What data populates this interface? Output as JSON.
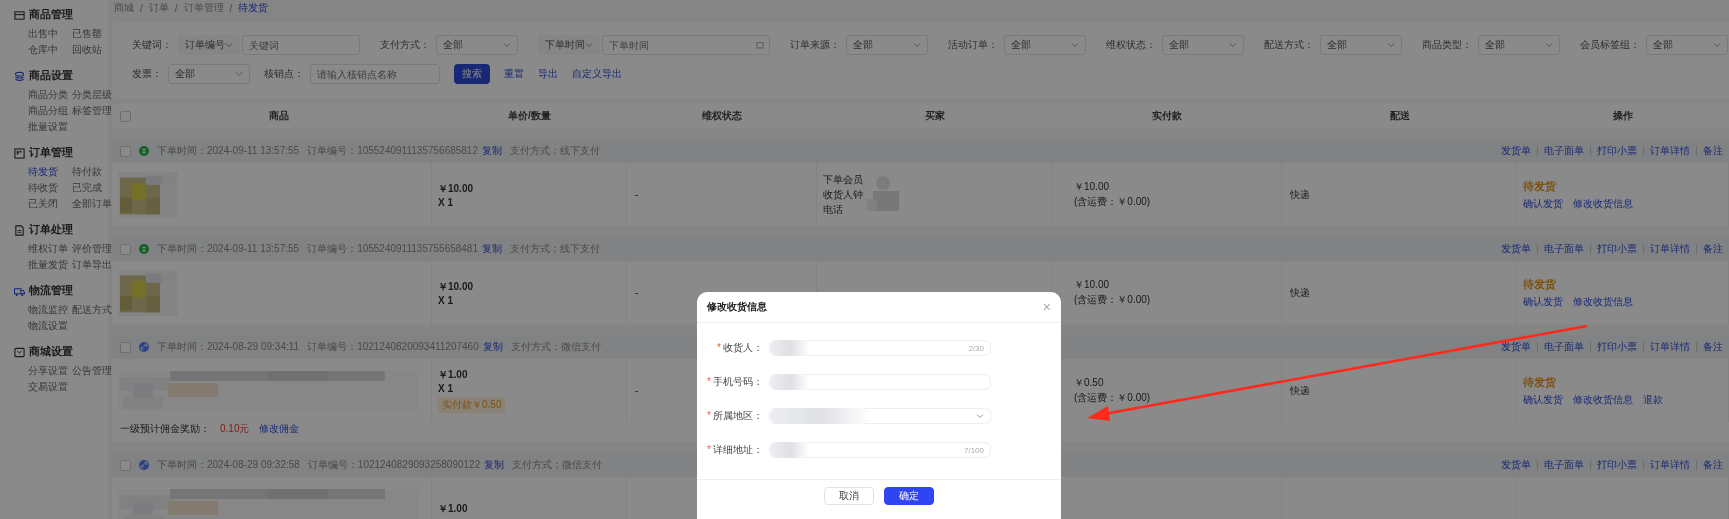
{
  "sidebar": {
    "groups": [
      {
        "title": "商品管理",
        "items": [
          {
            "label": "出售中",
            "selected": false
          },
          {
            "label": "已售罄",
            "selected": false
          },
          {
            "label": "仓库中",
            "selected": false
          },
          {
            "label": "回收站",
            "selected": false
          }
        ]
      },
      {
        "title": "商品设置",
        "items": [
          {
            "label": "商品分类",
            "selected": false
          },
          {
            "label": "分类层级",
            "selected": false
          },
          {
            "label": "商品分组",
            "selected": false
          },
          {
            "label": "标签管理",
            "selected": false
          },
          {
            "label": "批量设置",
            "selected": false
          }
        ]
      },
      {
        "title": "订单管理",
        "items": [
          {
            "label": "待发货",
            "selected": true
          },
          {
            "label": "待付款",
            "selected": false
          },
          {
            "label": "待收货",
            "selected": false
          },
          {
            "label": "已完成",
            "selected": false
          },
          {
            "label": "已关闭",
            "selected": false
          },
          {
            "label": "全部订单",
            "selected": false
          }
        ]
      },
      {
        "title": "订单处理",
        "items": [
          {
            "label": "维权订单",
            "selected": false
          },
          {
            "label": "评价管理",
            "selected": false
          },
          {
            "label": "批量发货",
            "selected": false
          },
          {
            "label": "订单导出",
            "selected": false
          }
        ]
      },
      {
        "title": "物流管理",
        "items": [
          {
            "label": "物流监控",
            "selected": false
          },
          {
            "label": "配送方式",
            "selected": false
          },
          {
            "label": "物流设置",
            "selected": false
          }
        ]
      },
      {
        "title": "商城设置",
        "items": [
          {
            "label": "分享设置",
            "selected": false
          },
          {
            "label": "公告管理",
            "selected": false
          },
          {
            "label": "交易设置",
            "selected": false
          }
        ]
      }
    ]
  },
  "breadcrumb": {
    "separator": "/",
    "items": [
      {
        "label": "商城",
        "selected": false
      },
      {
        "label": "订单",
        "selected": false
      },
      {
        "label": "订单管理",
        "selected": false
      },
      {
        "label": "待发货",
        "selected": true
      }
    ]
  },
  "filters": {
    "first_line": [
      {
        "kind": "select-input",
        "label": "关键词：",
        "select": "订单编号",
        "placeholder": "关键词"
      },
      {
        "kind": "select",
        "label": "支付方式：",
        "value": "全部"
      },
      {
        "kind": "date",
        "select": "下单时间",
        "placeholder": "下单时间"
      },
      {
        "kind": "select",
        "label": "订单来源：",
        "value": "全部"
      },
      {
        "kind": "select",
        "label": "活动订单：",
        "value": "全部"
      },
      {
        "kind": "select",
        "label": "维权状态：",
        "value": "全部"
      },
      {
        "kind": "select",
        "label": "配送方式：",
        "value": "全部"
      },
      {
        "kind": "select",
        "label": "商品类型：",
        "value": "全部"
      },
      {
        "kind": "select",
        "label": "会员标签组：",
        "value": "全部"
      }
    ],
    "second_line": [
      {
        "kind": "select",
        "label": "发票：",
        "value": "全部"
      },
      {
        "kind": "input",
        "label": "核销点：",
        "placeholder": "请输入核销点名称"
      },
      {
        "kind": "button",
        "label": "搜索"
      },
      {
        "kind": "link",
        "label": "重置"
      },
      {
        "kind": "link",
        "label": "导出"
      },
      {
        "kind": "link",
        "label": "自定义导出"
      }
    ]
  },
  "table": {
    "checked": false,
    "columns": [
      "商品",
      "单价/数量",
      "维权状态",
      "买家",
      "实付款",
      "配送",
      "操作"
    ],
    "orders": [
      {
        "checked": false,
        "kind": "offline",
        "time": "下单时间：2024-09-11 13:57:55",
        "number": "订单编号：1055240911135756685812",
        "copy": "复制",
        "payment": "支付方式：线下支付",
        "actions": [
          "发货单",
          "电子面单",
          "打印小票",
          "订单详情",
          "备注"
        ],
        "price": "￥10.00",
        "qty": "X 1",
        "rights": "-",
        "buyer": [
          "下单会员",
          "收货人钟",
          "电话"
        ],
        "paid": "￥10.00",
        "freight": "(含运费：￥0.00)",
        "delivery": "快递",
        "status": "待发货",
        "ops": [
          "确认发货",
          "修改收货信息"
        ]
      },
      {
        "checked": false,
        "kind": "offline",
        "time": "下单时间：2024-09-11 13:57:55",
        "number": "订单编号：1055240911135755658481",
        "copy": "复制",
        "payment": "支付方式：线下支付",
        "actions": [
          "发货单",
          "电子面单",
          "打印小票",
          "订单详情",
          "备注"
        ],
        "price": "￥10.00",
        "qty": "X 1",
        "rights": "-",
        "paid": "￥10.00",
        "freight": "(含运费：￥0.00)",
        "delivery": "快递",
        "status": "待发货",
        "ops": [
          "确认发货",
          "修改收货信息"
        ]
      },
      {
        "checked": false,
        "kind": "online",
        "time": "下单时间：2024-08-29 09:34:11",
        "number": "订单编号：1021240820093411207460",
        "copy": "复制",
        "payment": "支付方式：微信支付",
        "actions": [
          "发货单",
          "电子面单",
          "打印小票",
          "订单详情",
          "备注"
        ],
        "price": "￥1.00",
        "qty": "X 1",
        "badge": "实付款￥0.50",
        "rights": "-",
        "paid": "￥0.50",
        "freight": "(含运费：￥0.00)",
        "delivery": "快递",
        "status": "待发货",
        "ops": [
          "确认发货",
          "修改收货信息",
          "退款"
        ],
        "commission": {
          "label": "一级预计佣金奖励：",
          "amount": "0.10元",
          "link": "修改佣金"
        }
      },
      {
        "checked": false,
        "kind": "online",
        "time": "下单时间：2024-08-29 09:32:58",
        "number": "订单编号：1021240829093258090122",
        "copy": "复制",
        "payment": "支付方式：微信支付",
        "actions": [
          "发货单",
          "电子面单",
          "打印小票",
          "订单详情",
          "备注"
        ],
        "price": "￥1.00"
      }
    ]
  },
  "modal": {
    "title": "修改收货信息",
    "close": "×",
    "fields": [
      {
        "kind": "input",
        "required_mark": "*",
        "label": "收货人：",
        "counter": "2/30"
      },
      {
        "kind": "input",
        "required_mark": "*",
        "label": "手机号码："
      },
      {
        "kind": "select",
        "required_mark": "*",
        "label": "所属地区："
      },
      {
        "kind": "input",
        "required_mark": "*",
        "label": "详细地址：",
        "counter": "7/100"
      }
    ],
    "buttons": [
      {
        "kind": "secondary",
        "label": "取消"
      },
      {
        "kind": "primary",
        "label": "确定"
      }
    ]
  }
}
